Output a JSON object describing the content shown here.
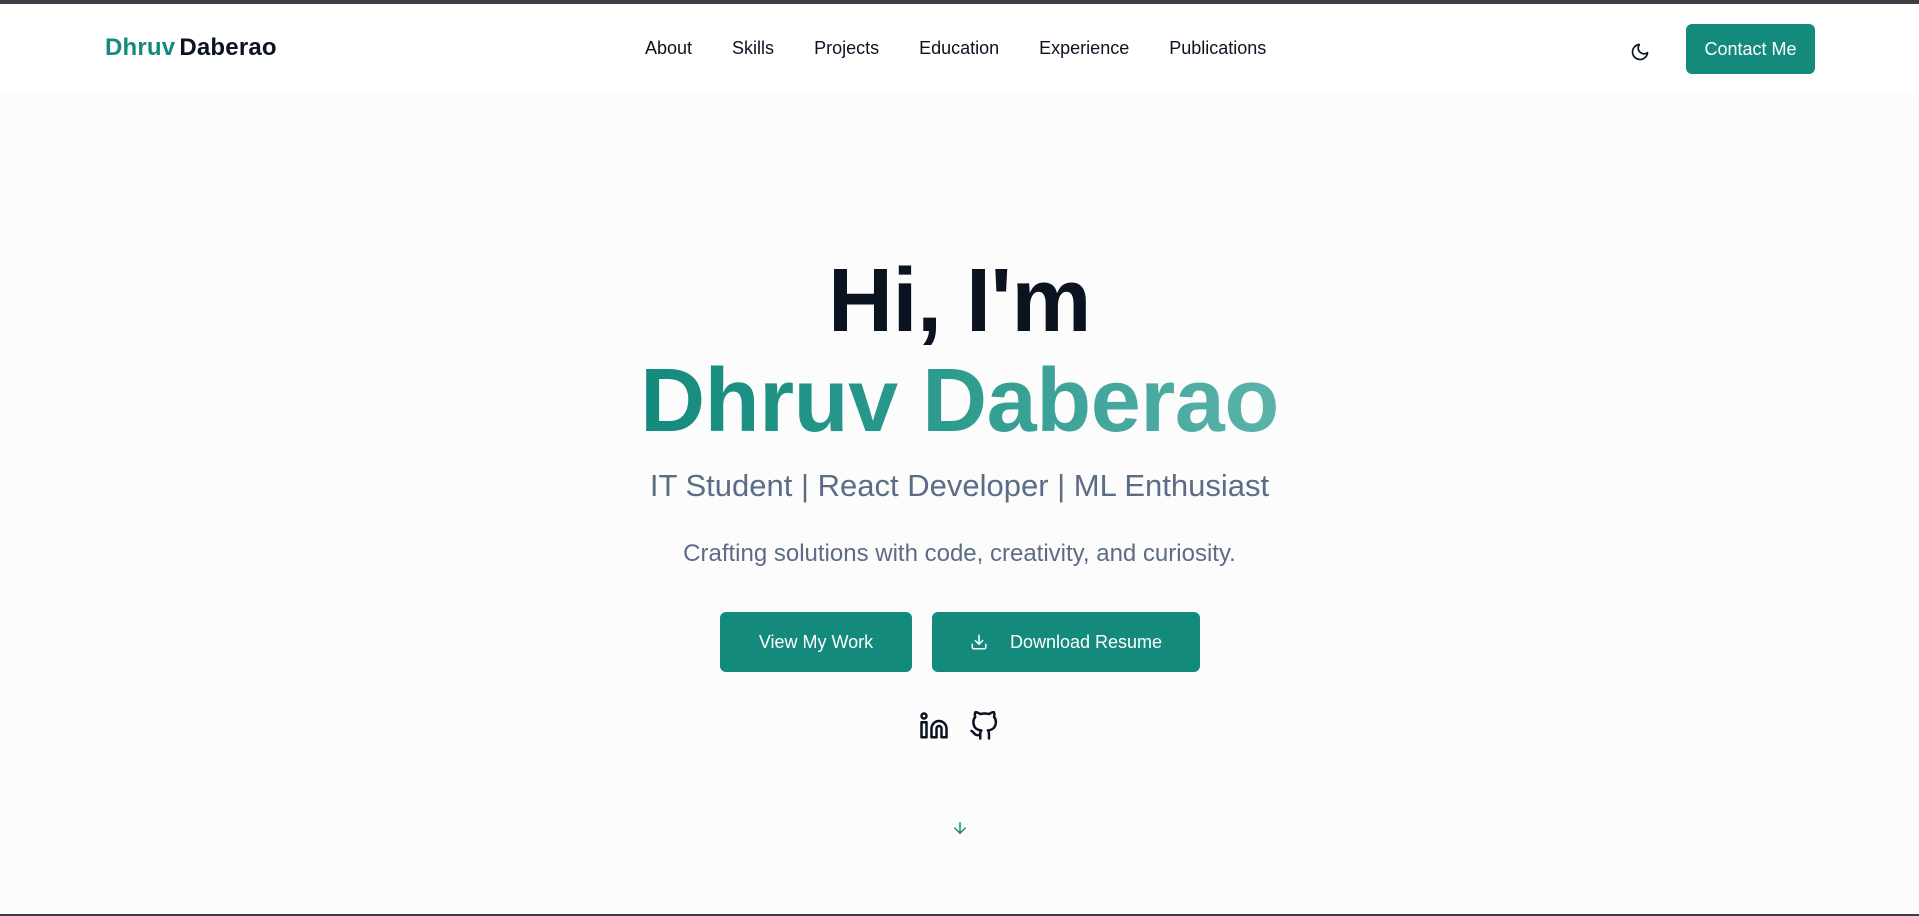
{
  "brand": {
    "first": "Dhruv",
    "last": "Daberao"
  },
  "nav": {
    "items": [
      "About",
      "Skills",
      "Projects",
      "Education",
      "Experience",
      "Publications"
    ]
  },
  "header": {
    "theme_icon": "moon-icon",
    "contact_label": "Contact Me"
  },
  "hero": {
    "greeting": "Hi, I'm",
    "name": "Dhruv Daberao",
    "subtitle": "IT Student | React Developer | ML Enthusiast",
    "tagline": "Crafting solutions with code, creativity, and curiosity.",
    "primary_button": "View My Work",
    "secondary_button": "Download Resume",
    "secondary_icon": "download-icon",
    "social": [
      {
        "icon": "linkedin-icon"
      },
      {
        "icon": "github-icon"
      }
    ],
    "scroll_icon": "arrow-down-icon"
  },
  "colors": {
    "accent": "#148a7d",
    "text_dark": "#0b1220",
    "text_muted": "#5d6c86"
  }
}
